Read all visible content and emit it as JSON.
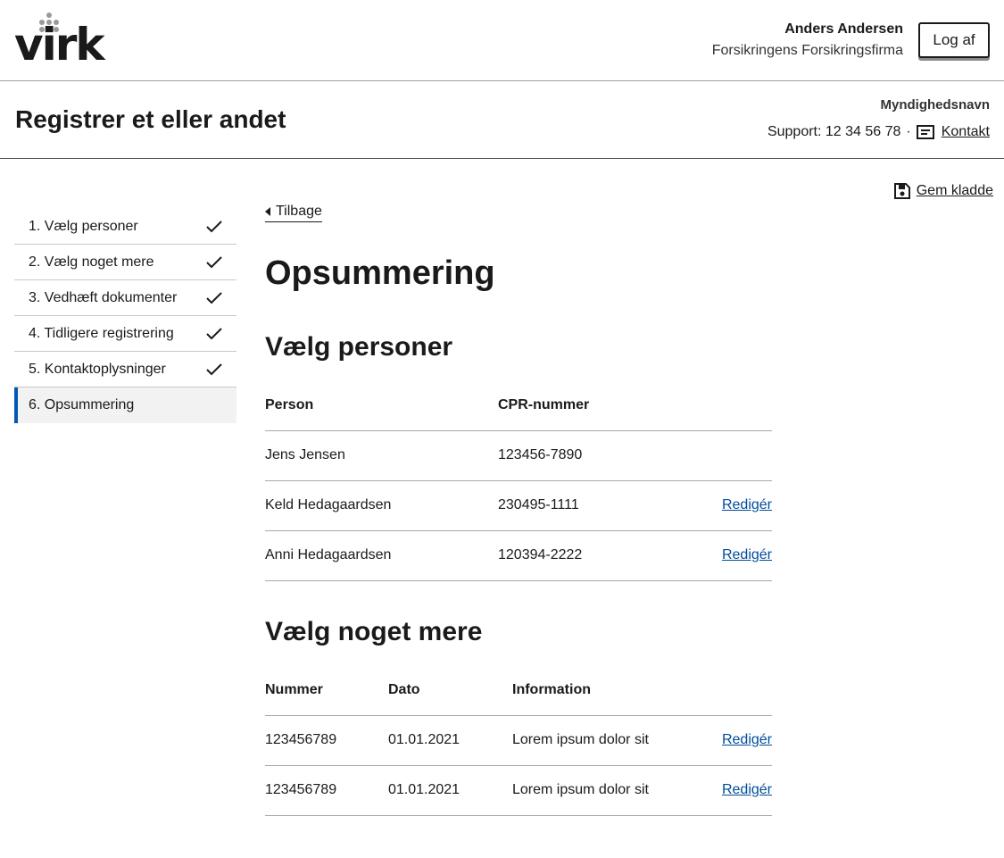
{
  "header": {
    "logo_text": "virk",
    "user_name": "Anders Andersen",
    "company": "Forsikringens Forsikringsfirma",
    "logout_label": "Log af"
  },
  "subheader": {
    "title": "Registrer et eller andet",
    "authority": "Myndighedsnavn",
    "support_text": "Support: 12 34 56 78",
    "separator": "·",
    "contact_label": "Kontakt"
  },
  "save_draft_label": "Gem kladde",
  "steps": [
    {
      "label": "1. Vælg personer",
      "done": true
    },
    {
      "label": "2. Vælg noget mere",
      "done": true
    },
    {
      "label": "3. Vedhæft dokumenter",
      "done": true
    },
    {
      "label": "4. Tidligere registrering",
      "done": true
    },
    {
      "label": "5. Kontaktoplysninger",
      "done": true
    },
    {
      "label": "6. Opsummering",
      "done": false,
      "active": true
    }
  ],
  "back_label": "Tilbage",
  "summary_title": "Opsummering",
  "persons_section": {
    "title": "Vælg personer",
    "headers": [
      "Person",
      "CPR-nummer"
    ],
    "rows": [
      {
        "person": "Jens Jensen",
        "cpr": "123456-7890",
        "edit": ""
      },
      {
        "person": "Keld Hedagaardsen",
        "cpr": "230495-1111",
        "edit": "Redigér"
      },
      {
        "person": "Anni Hedagaardsen",
        "cpr": "120394-2222",
        "edit": "Redigér"
      }
    ]
  },
  "more_section": {
    "title": "Vælg noget mere",
    "headers": [
      "Nummer",
      "Dato",
      "Information"
    ],
    "rows": [
      {
        "number": "123456789",
        "date": "01.01.2021",
        "info": "Lorem ipsum dolor sit",
        "edit": "Redigér"
      },
      {
        "number": "123456789",
        "date": "01.01.2021",
        "info": "Lorem ipsum dolor sit",
        "edit": "Redigér"
      }
    ]
  },
  "colors": {
    "accent": "#0059b3",
    "link": "#004d99",
    "active_bg": "#f2f2f2"
  }
}
